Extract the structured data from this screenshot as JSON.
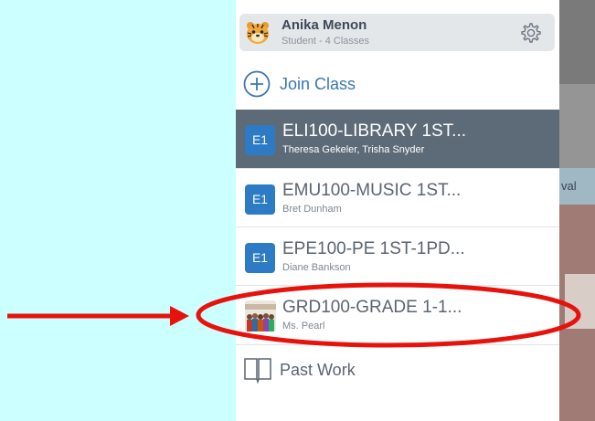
{
  "profile": {
    "name": "Anika Menon",
    "subtitle": "Student - 4 Classes",
    "avatar_icon": "tiger-avatar-icon",
    "settings_icon": "gear-icon"
  },
  "join_class": {
    "label": "Join Class",
    "icon": "plus-circle-icon"
  },
  "classes": [
    {
      "badge": "E1",
      "title": "ELI100-LIBRARY 1ST...",
      "teacher": "Theresa Gekeler,  Trisha Snyder",
      "selected": true
    },
    {
      "badge": "E1",
      "title": "EMU100-MUSIC 1ST...",
      "teacher": "Bret Dunham",
      "selected": false
    },
    {
      "badge": "E1",
      "title": "EPE100-PE 1ST-1PD...",
      "teacher": "Diane Bankson",
      "selected": false
    },
    {
      "badge": "",
      "title": "GRD100-GRADE 1-1...",
      "teacher": "Ms. Pearl",
      "selected": false,
      "thumbnail": "class-photo"
    }
  ],
  "past_work": {
    "label": "Past Work",
    "icon": "book-icon"
  },
  "background_app": {
    "partial_text": "val"
  },
  "annotation": {
    "arrow_color": "#e8120c",
    "ellipse_color": "#e8120c"
  },
  "colors": {
    "accent": "#2d7bc4",
    "selected_row": "#5d6b78",
    "page_bg": "#ccffff"
  }
}
